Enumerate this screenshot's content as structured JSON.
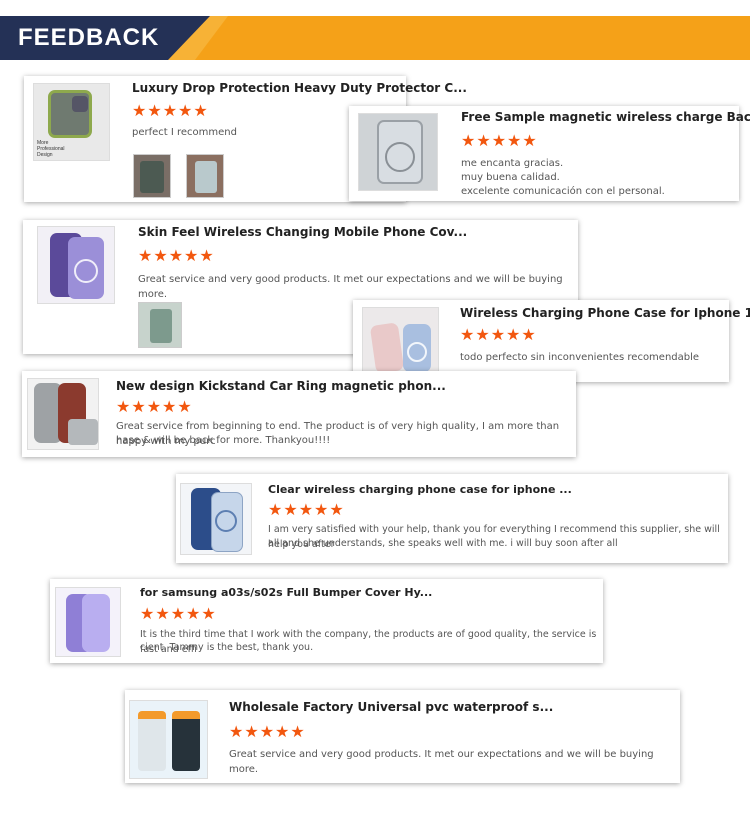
{
  "header": {
    "title": "FEEDBACK"
  },
  "colors": {
    "navy": "#243156",
    "orange": "#f5a118",
    "star": "#f2570f"
  },
  "rating_stars": "★★★★★",
  "reviews": [
    {
      "product": "Luxury Drop Protection Heavy Duty Protector C...",
      "comment": "perfect I recommend",
      "thumb_caption": "More Professional Design"
    },
    {
      "product": "Free Sample magnetic wireless charge Back C...",
      "comment_lines": [
        "me encanta gracias.",
        "muy buena calidad.",
        "excelente comunicación con el personal."
      ]
    },
    {
      "product": "Skin Feel Wireless Changing Mobile Phone Cov...",
      "comment": "Great service and very good products. It met our expectations and we will be  buying more."
    },
    {
      "product": "Wireless Charging Phone Case for Iphone 13 1...",
      "comment": "todo perfecto sin inconvenientes recomendable"
    },
    {
      "product": "New design Kickstand Car Ring magnetic phon...",
      "comment_lines": [
        "Great service from beginning to end. The product is of very high quality, I am more than happy with my purc",
        "hase & will be back for more. Thankyou!!!!"
      ]
    },
    {
      "product": "Clear wireless charging phone case for iphone ...",
      "comment_lines": [
        "I am very satisfied with your help, thank you for everything I recommend this supplier, she will help you after",
        "all and she understands, she speaks well with me. i will buy soon after all"
      ]
    },
    {
      "product": "for samsung a03s/s02s Full Bumper Cover Hy...",
      "comment_lines": [
        "It is the third time that I work with the company, the products are of good quality, the service is fast and effi",
        "cient. Tammy is the best, thank you."
      ]
    },
    {
      "product": "Wholesale Factory Universal pvc waterproof s...",
      "comment": "Great service and very good products. It met our expectations and we will be  buying more."
    }
  ]
}
